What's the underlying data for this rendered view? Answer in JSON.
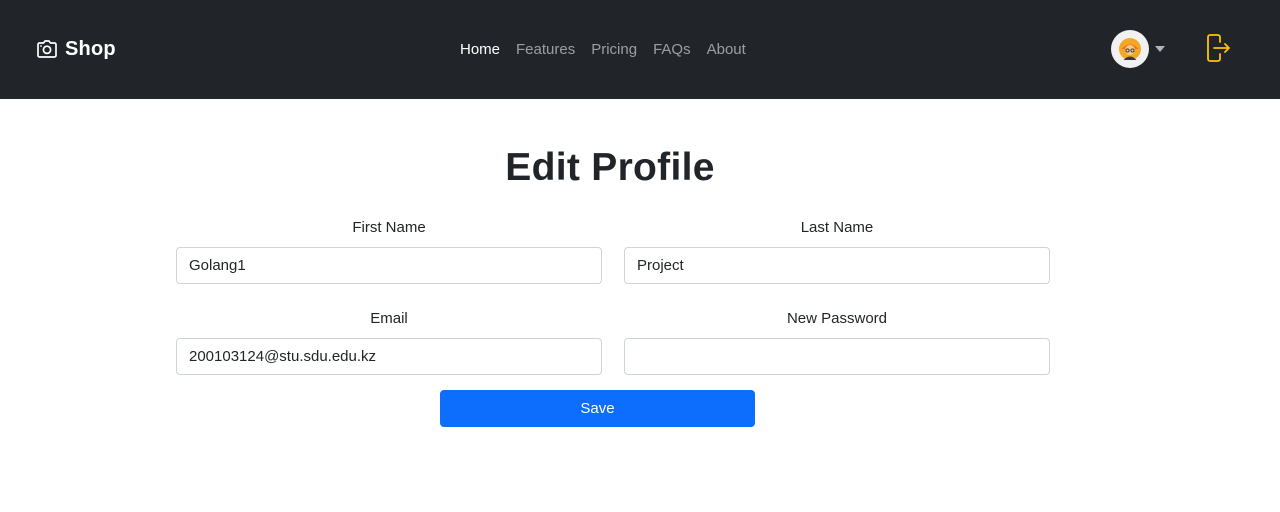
{
  "navbar": {
    "brand": {
      "label": "Shop",
      "icon": "camera-icon"
    },
    "links": [
      {
        "label": "Home",
        "active": true
      },
      {
        "label": "Features",
        "active": false
      },
      {
        "label": "Pricing",
        "active": false
      },
      {
        "label": "FAQs",
        "active": false
      },
      {
        "label": "About",
        "active": false
      }
    ],
    "user_menu": {
      "icon": "user-avatar",
      "caret_icon": "caret-down-icon"
    },
    "logout": {
      "icon": "logout-icon",
      "color": "#ffc107"
    }
  },
  "form": {
    "title": "Edit Profile",
    "first_name": {
      "label": "First Name",
      "value": "Golang1"
    },
    "last_name": {
      "label": "Last Name",
      "value": "Project"
    },
    "email": {
      "label": "Email",
      "value": "200103124@stu.sdu.edu.kz"
    },
    "new_password": {
      "label": "New Password",
      "value": ""
    },
    "save_label": "Save"
  },
  "colors": {
    "navbar_bg": "#212529",
    "primary": "#0d6efd",
    "accent": "#ffc107"
  }
}
